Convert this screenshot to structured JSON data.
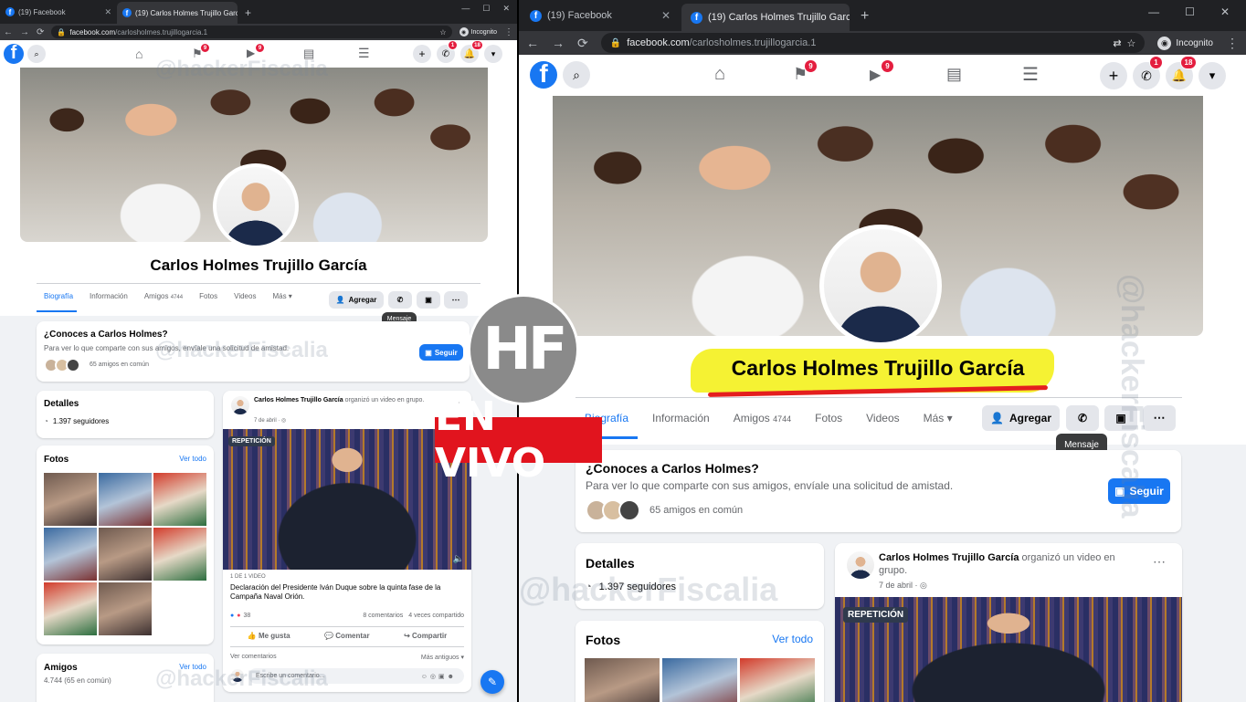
{
  "browser": {
    "tab_inactive": "(19) Facebook",
    "tab_active": "(19) Carlos Holmes Trujillo García",
    "new_tab": "+",
    "url_domain": "facebook.com",
    "url_path": "/carlosholmes.trujillogarcia.1",
    "incognito": "Incognito"
  },
  "fb": {
    "logo": "f",
    "notif_flag": "9",
    "notif_video": "9",
    "notif_messenger": "1",
    "notif_bell": "18"
  },
  "profile": {
    "name": "Carlos Holmes Trujillo García",
    "tabs": {
      "bio": "Biografía",
      "info": "Información",
      "friends": "Amigos",
      "friends_count": "4744",
      "photos": "Fotos",
      "videos": "Videos",
      "more": "Más"
    },
    "add_label": "Agregar",
    "tooltip": "Mensaje"
  },
  "know": {
    "title": "¿Conoces a Carlos Holmes?",
    "text": "Para ver lo que comparte con sus amigos, envíale una solicitud de amistad.",
    "mutual": "65 amigos en común",
    "follow": "Seguir"
  },
  "details": {
    "title": "Detalles",
    "followers": "1.397 seguidores"
  },
  "photos": {
    "title": "Fotos",
    "see_all": "Ver todo"
  },
  "friends": {
    "title": "Amigos",
    "count": "4.744 (65 en común)",
    "see_all": "Ver todo"
  },
  "post": {
    "author": "Carlos Holmes Trujillo García",
    "action": "organizó un video en grupo.",
    "date": "7 de abril",
    "badge": "REPETICIÓN",
    "video_count": "1 DE 1 VIDEO",
    "video_title": "Declaración del Presidente Iván Duque sobre la quinta fase de la Campaña Naval Orión.",
    "reactions": "38",
    "comments": "8 comentarios",
    "shares": "4 veces compartido",
    "like": "Me gusta",
    "comment": "Comentar",
    "share": "Compartir",
    "see_comments": "Ver comentarios",
    "older": "Más antiguos",
    "write": "Escribe un comentario..."
  },
  "overlay": {
    "logo": "HF",
    "live": "EN VIVO",
    "watermark": "@hackerFiscalia"
  },
  "colors": {
    "fb_blue": "#1877f2",
    "live_red": "#e1141e",
    "highlight": "#f5f233"
  }
}
